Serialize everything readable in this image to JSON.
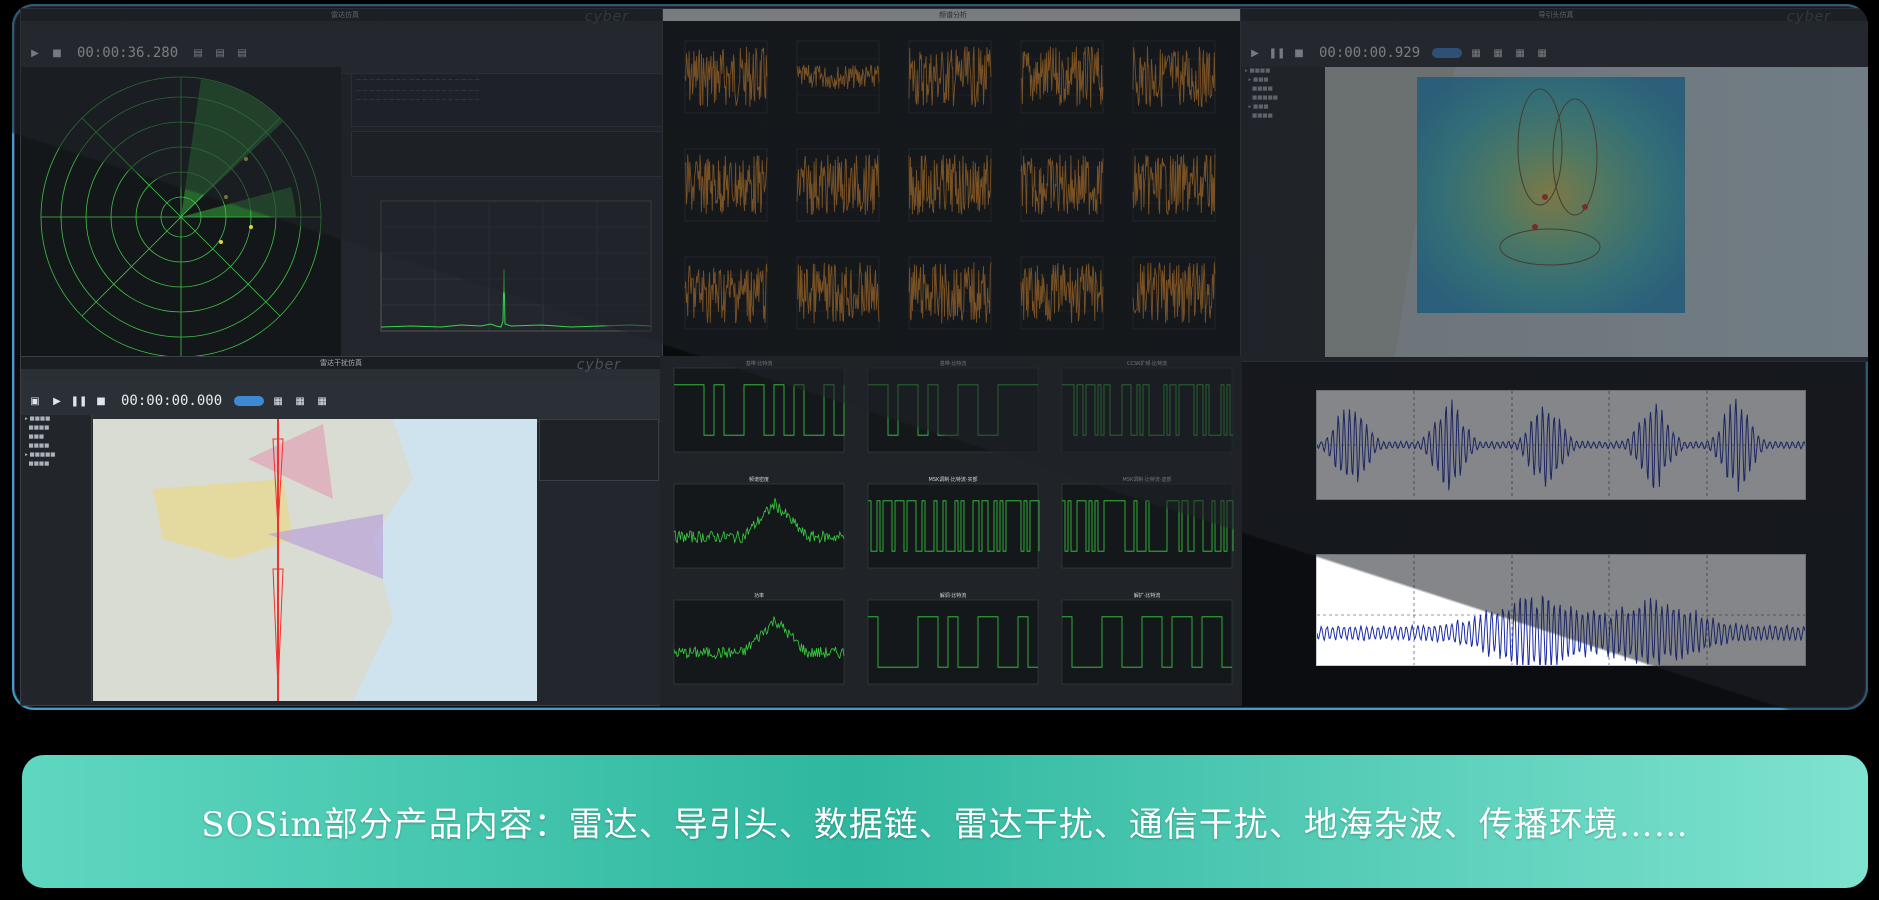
{
  "radar_window": {
    "title": "雷达仿真",
    "timer": "00:00:36.280",
    "logo": "cyber"
  },
  "orange_window": {
    "title": "频谱分析"
  },
  "map_window_top": {
    "title": "导引头仿真",
    "timer": "00:00:00.929",
    "logo": "cyber"
  },
  "map_window_bottom": {
    "title": "雷达干扰仿真",
    "timer": "00:00:00.000",
    "logo": "cyber"
  },
  "green_grid": {
    "titles": [
      "基带·比特流",
      "基带·比特流",
      "CCSK扩频·比特流",
      "频谱密度",
      "MSK调制·比特流·实部",
      "MSK调制·比特流·虚部",
      "功率",
      "解调·比特流",
      "解扩·比特流"
    ]
  },
  "banner": {
    "text": "SOSim部分产品内容：雷达、导引头、数据链、雷达干扰、通信干扰、地海杂波、传播环境……"
  }
}
